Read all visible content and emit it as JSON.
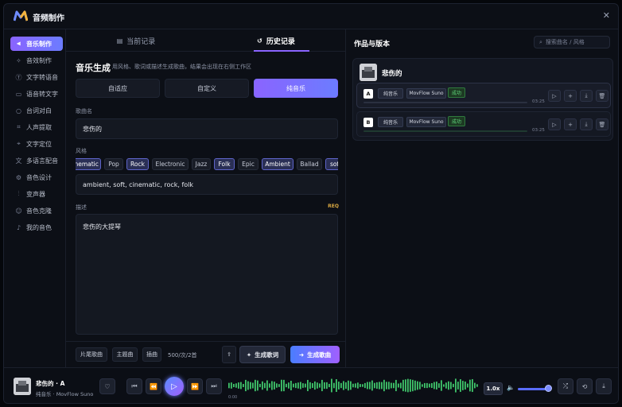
{
  "app": {
    "title": "音频制作"
  },
  "sidebar": {
    "items": [
      {
        "label": "音乐制作",
        "icon": "wave-icon"
      },
      {
        "label": "音效制作",
        "icon": "sparkle-icon"
      },
      {
        "label": "文字转语音",
        "icon": "text-icon"
      },
      {
        "label": "语音转文字",
        "icon": "transcribe-icon"
      },
      {
        "label": "台词对白",
        "icon": "chat-icon"
      },
      {
        "label": "人声提取",
        "icon": "extract-icon"
      },
      {
        "label": "文字定位",
        "icon": "locate-icon"
      },
      {
        "label": "多语言配音",
        "icon": "translate-icon"
      },
      {
        "label": "音色设计",
        "icon": "design-icon"
      },
      {
        "label": "变声器",
        "icon": "voice-change-icon"
      },
      {
        "label": "音色克隆",
        "icon": "clone-icon"
      },
      {
        "label": "我的音色",
        "icon": "mic-icon"
      }
    ]
  },
  "tabs": [
    {
      "label": "当前记录"
    },
    {
      "label": "历史记录"
    }
  ],
  "generator": {
    "title": "音乐生成",
    "subtitle": "用风格、歌词或描述生成歌曲，结果会出现在右侧工作区",
    "modes": [
      "自适应",
      "自定义",
      "纯音乐"
    ],
    "song_name_label": "歌曲名",
    "song_name_value": "悲伤的",
    "style_label": "风格",
    "style_chips": [
      "Cinematic",
      "Pop",
      "Rock",
      "Electronic",
      "Jazz",
      "Folk",
      "Epic",
      "Ambient",
      "Ballad",
      "soft"
    ],
    "style_value": "ambient, soft, cinematic, rock, folk",
    "desc_label": "描述",
    "req_badge": "REQ",
    "desc_value": "悲伤的大提琴"
  },
  "bottom": {
    "btn1": "片尾歌曲",
    "btn2": "主题曲",
    "btn3": "插曲",
    "count": "500/次/2首",
    "gen_lyrics": "生成歌词",
    "gen_song": "生成歌曲"
  },
  "works": {
    "title": "作品与版本",
    "search_placeholder": "搜索曲名 / 风格",
    "track_title": "悲伤的",
    "versions": [
      {
        "tag": "A",
        "type": "纯音乐",
        "model": "MovFlow Suno",
        "status": "成功",
        "time": "03:25"
      },
      {
        "tag": "B",
        "type": "纯音乐",
        "model": "MovFlow Suno",
        "status": "成功",
        "time": "03:25"
      }
    ]
  },
  "player": {
    "title": "悲伤的 · A",
    "subtitle": "纯音乐 · MovFlow Suno",
    "elapsed": "0:00",
    "speed": "1.0x",
    "volume": 0.85,
    "colors": {
      "wave": "#3fc46a",
      "accent": "#6c7cff"
    }
  }
}
